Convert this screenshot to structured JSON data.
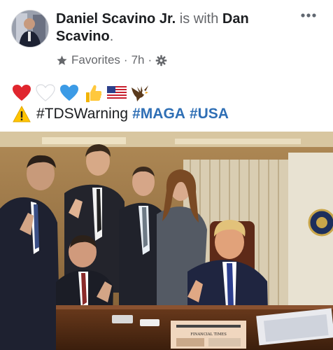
{
  "post": {
    "author": "Daniel Scavino Jr.",
    "is_with_text": "is with",
    "tagged_person": "Dan Scavino",
    "title_end": ".",
    "audience": "Favorites",
    "separator": "·",
    "time": "7h",
    "emojis": [
      "red-heart",
      "white-heart",
      "blue-heart",
      "thumbs-up",
      "us-flag",
      "eagle"
    ],
    "caption": {
      "warning_emoji": "warning",
      "hashtag_1": "#TDSWarning",
      "hashtag_2": "#MAGA",
      "hashtag_3": "#USA"
    },
    "photo": {
      "newspaper_masthead": "FINANCIAL TIMES"
    }
  },
  "colors": {
    "link": "#2f6fb5",
    "meta_text": "#65676b",
    "text": "#1c1e21"
  },
  "icons": {
    "audience": "star-icon",
    "settings": "gear-icon",
    "more": "more-options-icon"
  }
}
